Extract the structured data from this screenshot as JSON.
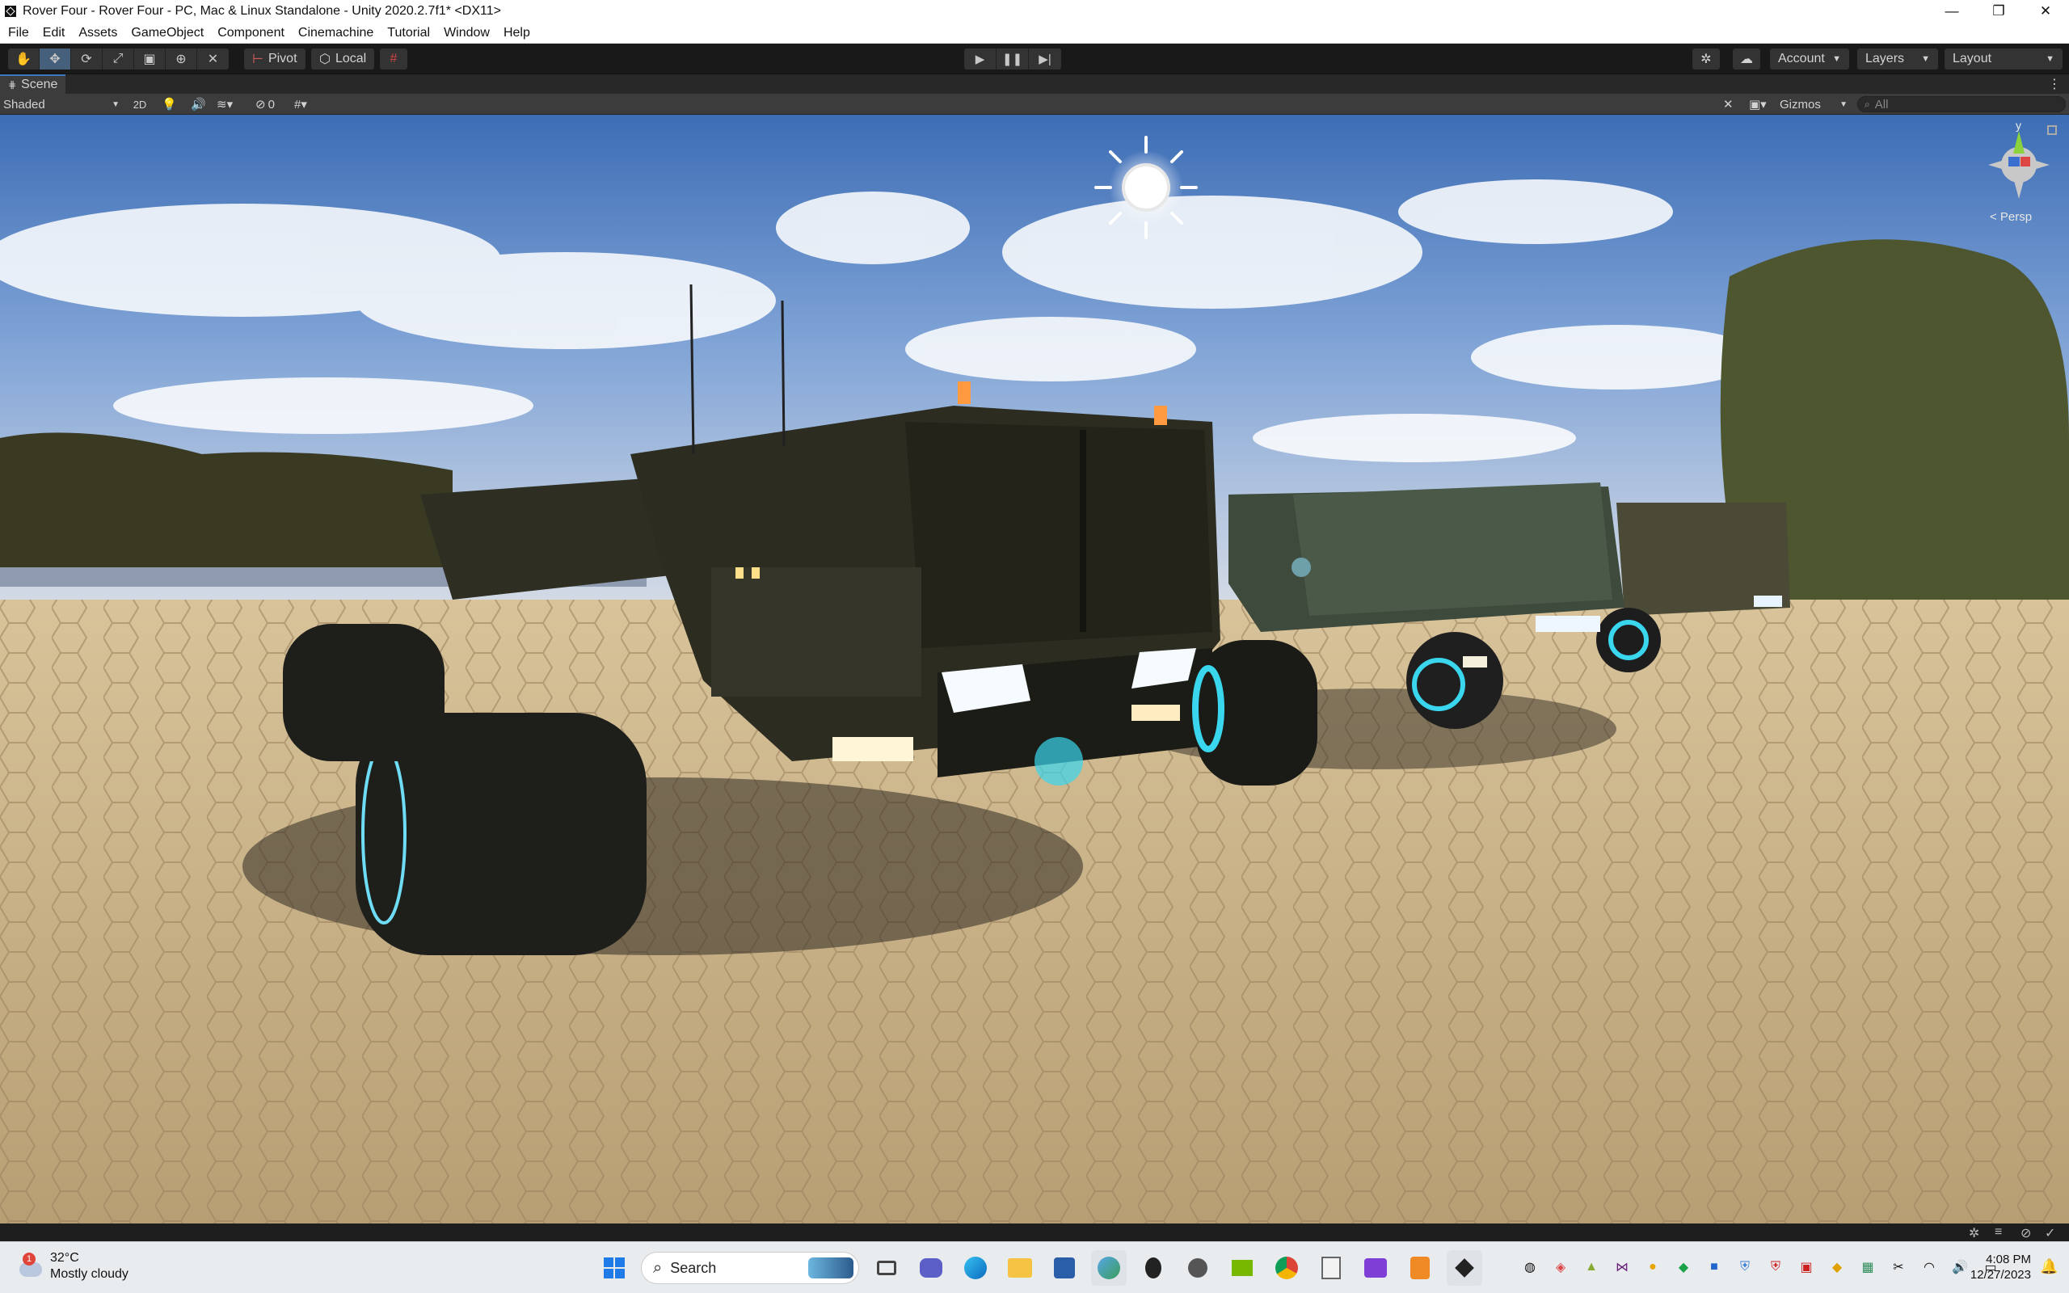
{
  "window": {
    "title": "Rover Four - Rover Four - PC, Mac & Linux Standalone - Unity 2020.2.7f1* <DX11>",
    "controls": [
      "—",
      "❐",
      "✕"
    ]
  },
  "menu": [
    "File",
    "Edit",
    "Assets",
    "GameObject",
    "Component",
    "Cinemachine",
    "Tutorial",
    "Window",
    "Help"
  ],
  "toolbar": {
    "tools": [
      "hand-tool-icon",
      "move-tool-icon",
      "rotate-tool-icon",
      "scale-tool-icon",
      "rect-tool-icon",
      "transform-tool-icon",
      "custom-tool-icon"
    ],
    "pivot_label": "Pivot",
    "space_label": "Local",
    "account_label": "Account",
    "layers_label": "Layers",
    "layout_label": "Layout"
  },
  "scene_tab": {
    "label": "Scene",
    "shading_mode": "Shaded",
    "mode_2d": "2D",
    "hidden_count": "0",
    "gizmos_label": "Gizmos",
    "search_placeholder": "All",
    "projection_label": "< Persp"
  },
  "gizmo_axis": "y",
  "taskbar": {
    "weather_temp": "32°C",
    "weather_desc": "Mostly cloudy",
    "weather_badge": "1",
    "search_label": "Search",
    "time": "4:08 PM",
    "date": "12/27/2023"
  },
  "colors": {
    "accent": "#3a79bb",
    "editor_bg": "#191919",
    "sky": "#5b86c4",
    "ground": "#cdb48a"
  }
}
